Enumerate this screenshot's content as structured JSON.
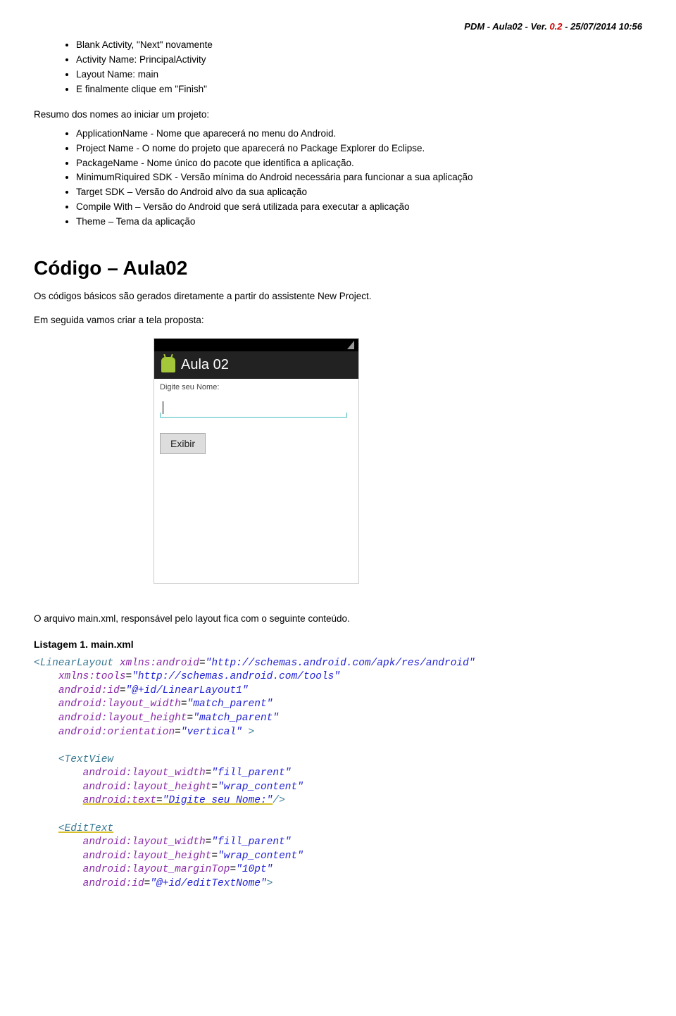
{
  "header": {
    "title_bold": "PDM - Aula02 - Ver. ",
    "title_red": "0.2",
    "title_tail": " - 25/07/2014 10:56"
  },
  "list1": {
    "items": [
      "Blank Activity, \"Next\" novamente",
      "Activity Name: PrincipalActivity",
      "Layout Name: main",
      "E finalmente clique em \"Finish\""
    ]
  },
  "para_resume": "Resumo dos nomes ao iniciar um projeto:",
  "list2": {
    "items": [
      "ApplicationName - Nome que aparecerá no menu do Android.",
      "Project Name - O nome do projeto que aparecerá no Package Explorer do Eclipse.",
      "PackageName - Nome único do pacote que identifica a aplicação.",
      "MinimumRiquired SDK - Versão mínima do Android necessária para funcionar a sua aplicação",
      "Target SDK – Versão do Android alvo da sua aplicação",
      "Compile With – Versão do Android que será utilizada para executar a aplicação",
      "Theme – Tema da aplicação"
    ]
  },
  "heading_code": "Código – Aula02",
  "para_code1": "Os códigos básicos são gerados diretamente a partir do assistente New Project.",
  "para_code2": "Em seguida vamos criar a tela proposta:",
  "android": {
    "titlebar": "Aula 02",
    "label": "Digite seu Nome:",
    "button": "Exibir"
  },
  "para_file": "O arquivo main.xml, responsável pelo layout fica com o seguinte conteúdo.",
  "listing_title": "Listagem 1. main.xml",
  "code": {
    "ll_open": "<LinearLayout",
    "ll_xmlns_attr": "xmlns:android",
    "ll_xmlns_val": "\"http://schemas.android.com/apk/res/android\"",
    "ll_tools_attr": "xmlns:tools",
    "ll_tools_val": "\"http://schemas.android.com/tools\"",
    "ll_id_attr": "android:id",
    "ll_id_val": "\"@+id/LinearLayout1\"",
    "ll_w_attr": "android:layout_width",
    "ll_w_val": "\"match_parent\"",
    "ll_h_attr": "android:layout_height",
    "ll_h_val": "\"match_parent\"",
    "ll_or_attr": "android:orientation",
    "ll_or_val": "\"vertical\"",
    "gt": " >",
    "tv_open": "<TextView",
    "tv_w_attr": "android:layout_width",
    "tv_w_val": "\"fill_parent\"",
    "tv_h_attr": "android:layout_height",
    "tv_h_val": "\"wrap_content\"",
    "tv_t_attr": "android:text",
    "tv_t_val": "\"Digite seu Nome:\"",
    "selfclose": "/>",
    "et_open": "<EditText",
    "et_w_attr": "android:layout_width",
    "et_w_val": "\"fill_parent\"",
    "et_h_attr": "android:layout_height",
    "et_h_val": "\"wrap_content\"",
    "et_m_attr": "android:layout_marginTop",
    "et_m_val": "\"10pt\"",
    "et_id_attr": "android:id",
    "et_id_val": "\"@+id/editTextNome\"",
    "et_close": ">"
  }
}
